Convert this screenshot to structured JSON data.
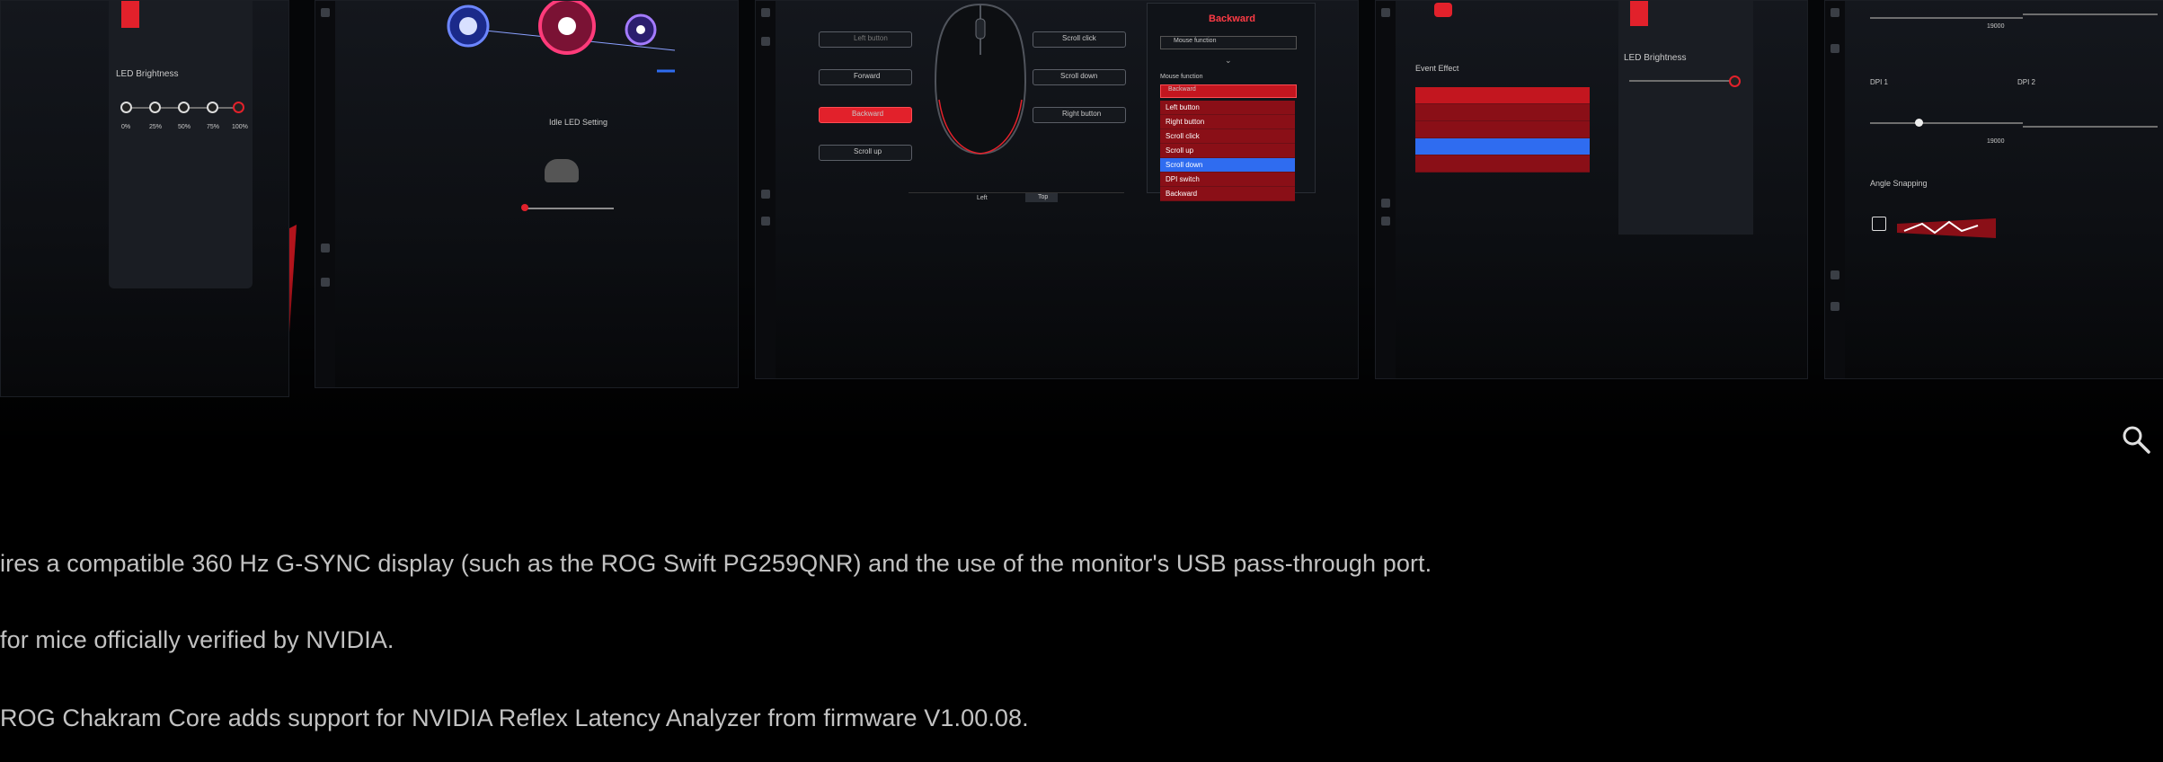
{
  "hero": {
    "panel1": {
      "title": "LED Brightness",
      "ticks": [
        "0%",
        "25%",
        "50%",
        "75%",
        "100%"
      ]
    },
    "panel2": {
      "label": "Idle LED Setting"
    },
    "panel3": {
      "left_buttons": [
        "Left button",
        "Forward",
        "Backward",
        "Scroll up"
      ],
      "right_buttons": [
        "Scroll click",
        "Scroll down",
        "Right button"
      ],
      "bottom_tabs": [
        "Left",
        "Top"
      ],
      "popup": {
        "title": "Backward",
        "type_select": "Mouse function",
        "function_label": "Mouse function",
        "selected": "Backward",
        "options": [
          "Left button",
          "Right button",
          "Scroll click",
          "Scroll up",
          "Scroll down",
          "DPI switch",
          "Backward"
        ],
        "highlighted_index": 4
      }
    },
    "panel4": {
      "title": "LED Brightness",
      "list_label": "Event Effect"
    },
    "panel5": {
      "label_a": "DPI 1",
      "label_b": "DPI 2",
      "section": "Angle Snapping",
      "max_a": "19000",
      "max_b": "19000"
    }
  },
  "zoom_icon": "magnifier-icon",
  "notes": [
    "ires a compatible 360 Hz G-SYNC display (such as the ROG Swift PG259QNR) and the use of the monitor's USB pass-through port.",
    "for mice officially verified by NVIDIA.",
    "ROG Chakram Core adds support for NVIDIA Reflex Latency Analyzer from firmware V1.00.08."
  ],
  "colors": {
    "accent_red": "#e2212b",
    "accent_blue": "#2f6cf0",
    "background": "#000000",
    "text": "#c2c2c2"
  }
}
